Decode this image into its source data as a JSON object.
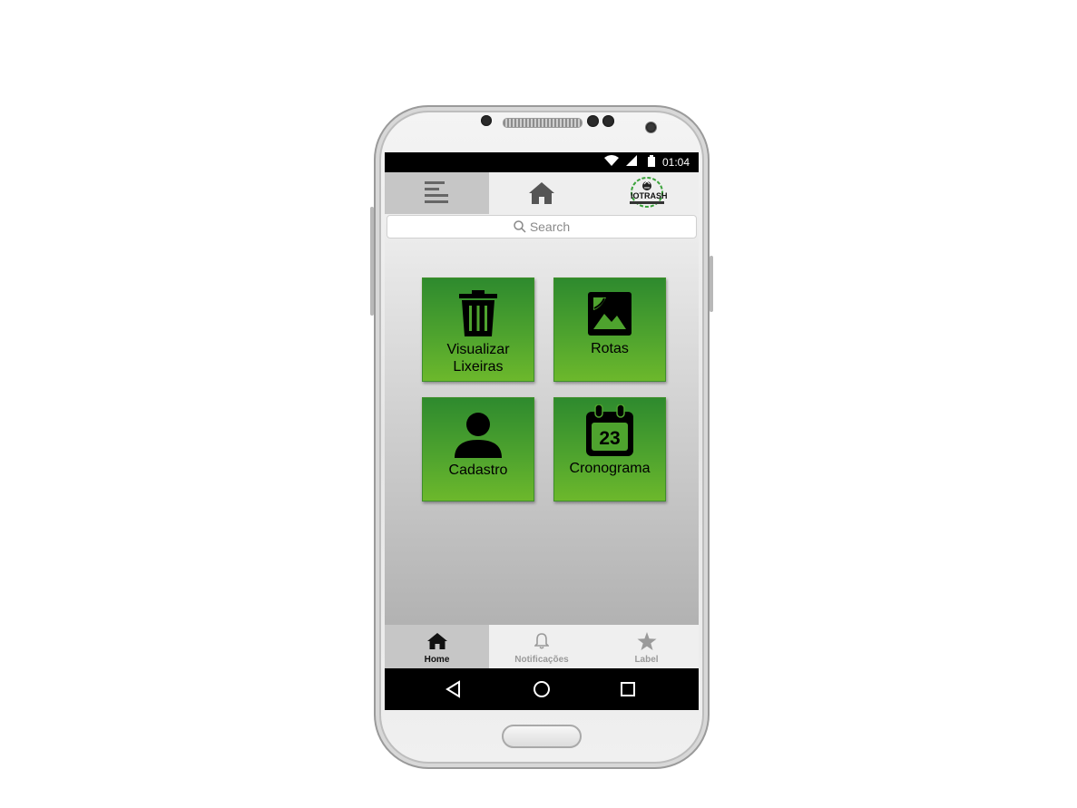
{
  "status_bar": {
    "time": "01:04"
  },
  "search": {
    "placeholder": "Search"
  },
  "logo": {
    "text": "IOTRASH"
  },
  "tiles": [
    {
      "label_line1": "Visualizar",
      "label_line2": "Lixeiras",
      "icon": "trash-icon"
    },
    {
      "label_line1": "Rotas",
      "icon": "image-icon"
    },
    {
      "label_line1": "Cadastro",
      "icon": "person-icon"
    },
    {
      "label_line1": "Cronograma",
      "icon": "calendar-icon",
      "calendar_day": "23"
    }
  ],
  "bottom_nav": [
    {
      "label": "Home",
      "icon": "home-icon",
      "active": true
    },
    {
      "label": "Notificações",
      "icon": "bell-icon",
      "active": false
    },
    {
      "label": "Label",
      "icon": "star-icon",
      "active": false
    }
  ],
  "colors": {
    "tile_green_top": "#2e8a2e",
    "tile_green_bottom": "#6cb82c",
    "appbar_bg": "#eeeeee",
    "active_tab_bg": "#c6c6c6",
    "status_bar_bg": "#000000"
  }
}
